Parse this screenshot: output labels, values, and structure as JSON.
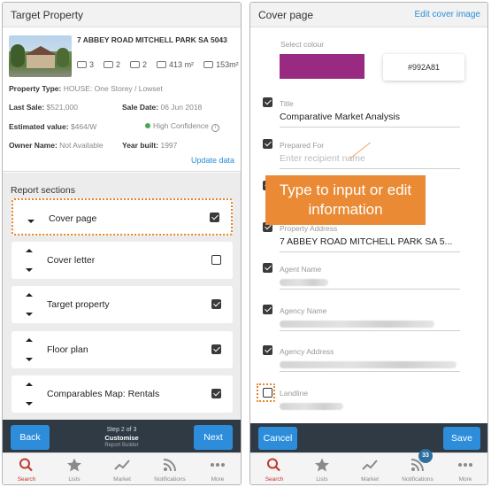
{
  "left": {
    "header_title": "Target Property",
    "property": {
      "address": "7 ABBEY ROAD MITCHELL PARK SA 5043",
      "beds": "3",
      "baths": "2",
      "cars": "2",
      "land": "413 m²",
      "floor": "153m²",
      "type_label": "Property Type:",
      "type_value": "HOUSE: One Storey / Lowset",
      "last_sale_label": "Last Sale:",
      "last_sale_value": "$521,000",
      "sale_date_label": "Sale Date:",
      "sale_date_value": "06 Jun 2018",
      "est_label": "Estimated value:",
      "est_value": "$464/W",
      "confidence": "High Confidence",
      "owner_label": "Owner Name:",
      "owner_value": "Not Available",
      "year_label": "Year built:",
      "year_value": "1997",
      "update_link": "Update data"
    },
    "sections_title": "Report sections",
    "sections": [
      {
        "label": "Cover page",
        "checked": true
      },
      {
        "label": "Cover letter",
        "checked": false
      },
      {
        "label": "Target property",
        "checked": true
      },
      {
        "label": "Floor plan",
        "checked": true
      },
      {
        "label": "Comparables Map: Rentals",
        "checked": true
      }
    ],
    "stepbar": {
      "back": "Back",
      "next": "Next",
      "step": "Step 2 of 3",
      "stage": "Customise",
      "sub": "Report Builder"
    }
  },
  "right": {
    "header_title": "Cover page",
    "edit_link": "Edit cover image",
    "select_colour_label": "Select colour",
    "colour_hex": "#992A81",
    "fields": {
      "title_label": "Title",
      "title_value": "Comparative Market Analysis",
      "prepared_label": "Prepared For",
      "prepared_placeholder": "Enter recipient name",
      "address_label": "Property Address",
      "address_value": "7 ABBEY ROAD MITCHELL PARK SA 5...",
      "agent_label": "Agent Name",
      "agency_label": "Agency Name",
      "agency_addr_label": "Agency Address",
      "landline_label": "Landline"
    },
    "tooltip": "Type to input or edit information",
    "cancel": "Cancel",
    "save": "Save"
  },
  "tabs": [
    {
      "label": "Search",
      "icon": "search-icon"
    },
    {
      "label": "Lists",
      "icon": "star-icon"
    },
    {
      "label": "Market",
      "icon": "trend-icon"
    },
    {
      "label": "Notifications",
      "icon": "rss-icon"
    },
    {
      "label": "More",
      "icon": "more-icon"
    }
  ],
  "notification_count": "33",
  "colors": {
    "accent": "#2d8ddb",
    "highlight": "#e8842a",
    "swatch": "#992A81",
    "active_tab": "#c0392b",
    "bar": "#2f3a45"
  }
}
